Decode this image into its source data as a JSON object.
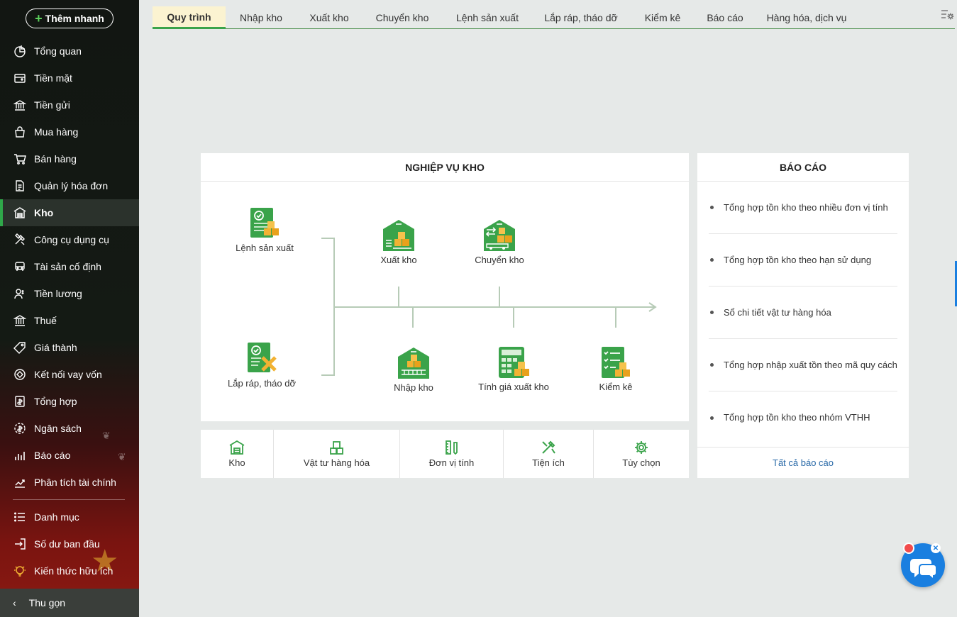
{
  "sidebar": {
    "quick_add": "Thêm nhanh",
    "items": [
      {
        "label": "Tổng quan",
        "icon": "chart-pie-icon"
      },
      {
        "label": "Tiền mặt",
        "icon": "cash-icon"
      },
      {
        "label": "Tiền gửi",
        "icon": "bank-icon"
      },
      {
        "label": "Mua hàng",
        "icon": "shopping-bag-icon"
      },
      {
        "label": "Bán hàng",
        "icon": "cart-icon"
      },
      {
        "label": "Quản lý hóa đơn",
        "icon": "invoice-icon"
      },
      {
        "label": "Kho",
        "icon": "warehouse-icon"
      },
      {
        "label": "Công cụ dụng cụ",
        "icon": "tools-icon"
      },
      {
        "label": "Tài sản cố định",
        "icon": "car-icon"
      },
      {
        "label": "Tiền lương",
        "icon": "salary-icon"
      },
      {
        "label": "Thuế",
        "icon": "tax-icon"
      },
      {
        "label": "Giá thành",
        "icon": "price-tag-icon"
      },
      {
        "label": "Kết nối vay vốn",
        "icon": "loan-icon"
      },
      {
        "label": "Tổng hợp",
        "icon": "summary-icon"
      },
      {
        "label": "Ngân sách",
        "icon": "budget-icon"
      },
      {
        "label": "Báo cáo",
        "icon": "report-chart-icon"
      },
      {
        "label": "Phân tích tài chính",
        "icon": "analysis-icon"
      }
    ],
    "items2": [
      {
        "label": "Danh mục",
        "icon": "list-icon"
      },
      {
        "label": "Số dư ban đầu",
        "icon": "opening-balance-icon"
      },
      {
        "label": "Kiến thức hữu ích",
        "icon": "knowledge-icon"
      }
    ],
    "collapse": "Thu gọn"
  },
  "tabs": [
    "Quy trình",
    "Nhập kho",
    "Xuất kho",
    "Chuyển kho",
    "Lệnh sản xuất",
    "Lắp ráp, tháo dỡ",
    "Kiểm kê",
    "Báo cáo",
    "Hàng hóa, dịch vụ"
  ],
  "process": {
    "title": "NGHIỆP VỤ KHO",
    "items": {
      "lenh_san_xuat": "Lệnh sản xuất",
      "lap_rap": "Lắp ráp, tháo dỡ",
      "xuat_kho": "Xuất kho",
      "chuyen_kho": "Chuyển kho",
      "nhap_kho": "Nhập kho",
      "tinh_gia": "Tính giá xuất kho",
      "kiem_ke": "Kiểm kê"
    }
  },
  "shortcuts": [
    "Kho",
    "Vật tư hàng hóa",
    "Đơn vị tính",
    "Tiện ích",
    "Tùy chọn"
  ],
  "reports": {
    "title": "BÁO CÁO",
    "items": [
      "Tổng hợp tồn kho theo nhiều đơn vị tính",
      "Tổng hợp tồn kho theo hạn sử dụng",
      "Sổ chi tiết vật tư hàng hóa",
      "Tổng hợp nhập xuất tồn theo mã quy cách",
      "Tổng hợp tồn kho theo nhóm VTHH"
    ],
    "all_link": "Tất cả báo cáo"
  },
  "colors": {
    "accent": "#3aa34a",
    "active_tab_bg": "#fbf3d1",
    "link": "#2a6aa8",
    "chat": "#1a7fe0"
  }
}
